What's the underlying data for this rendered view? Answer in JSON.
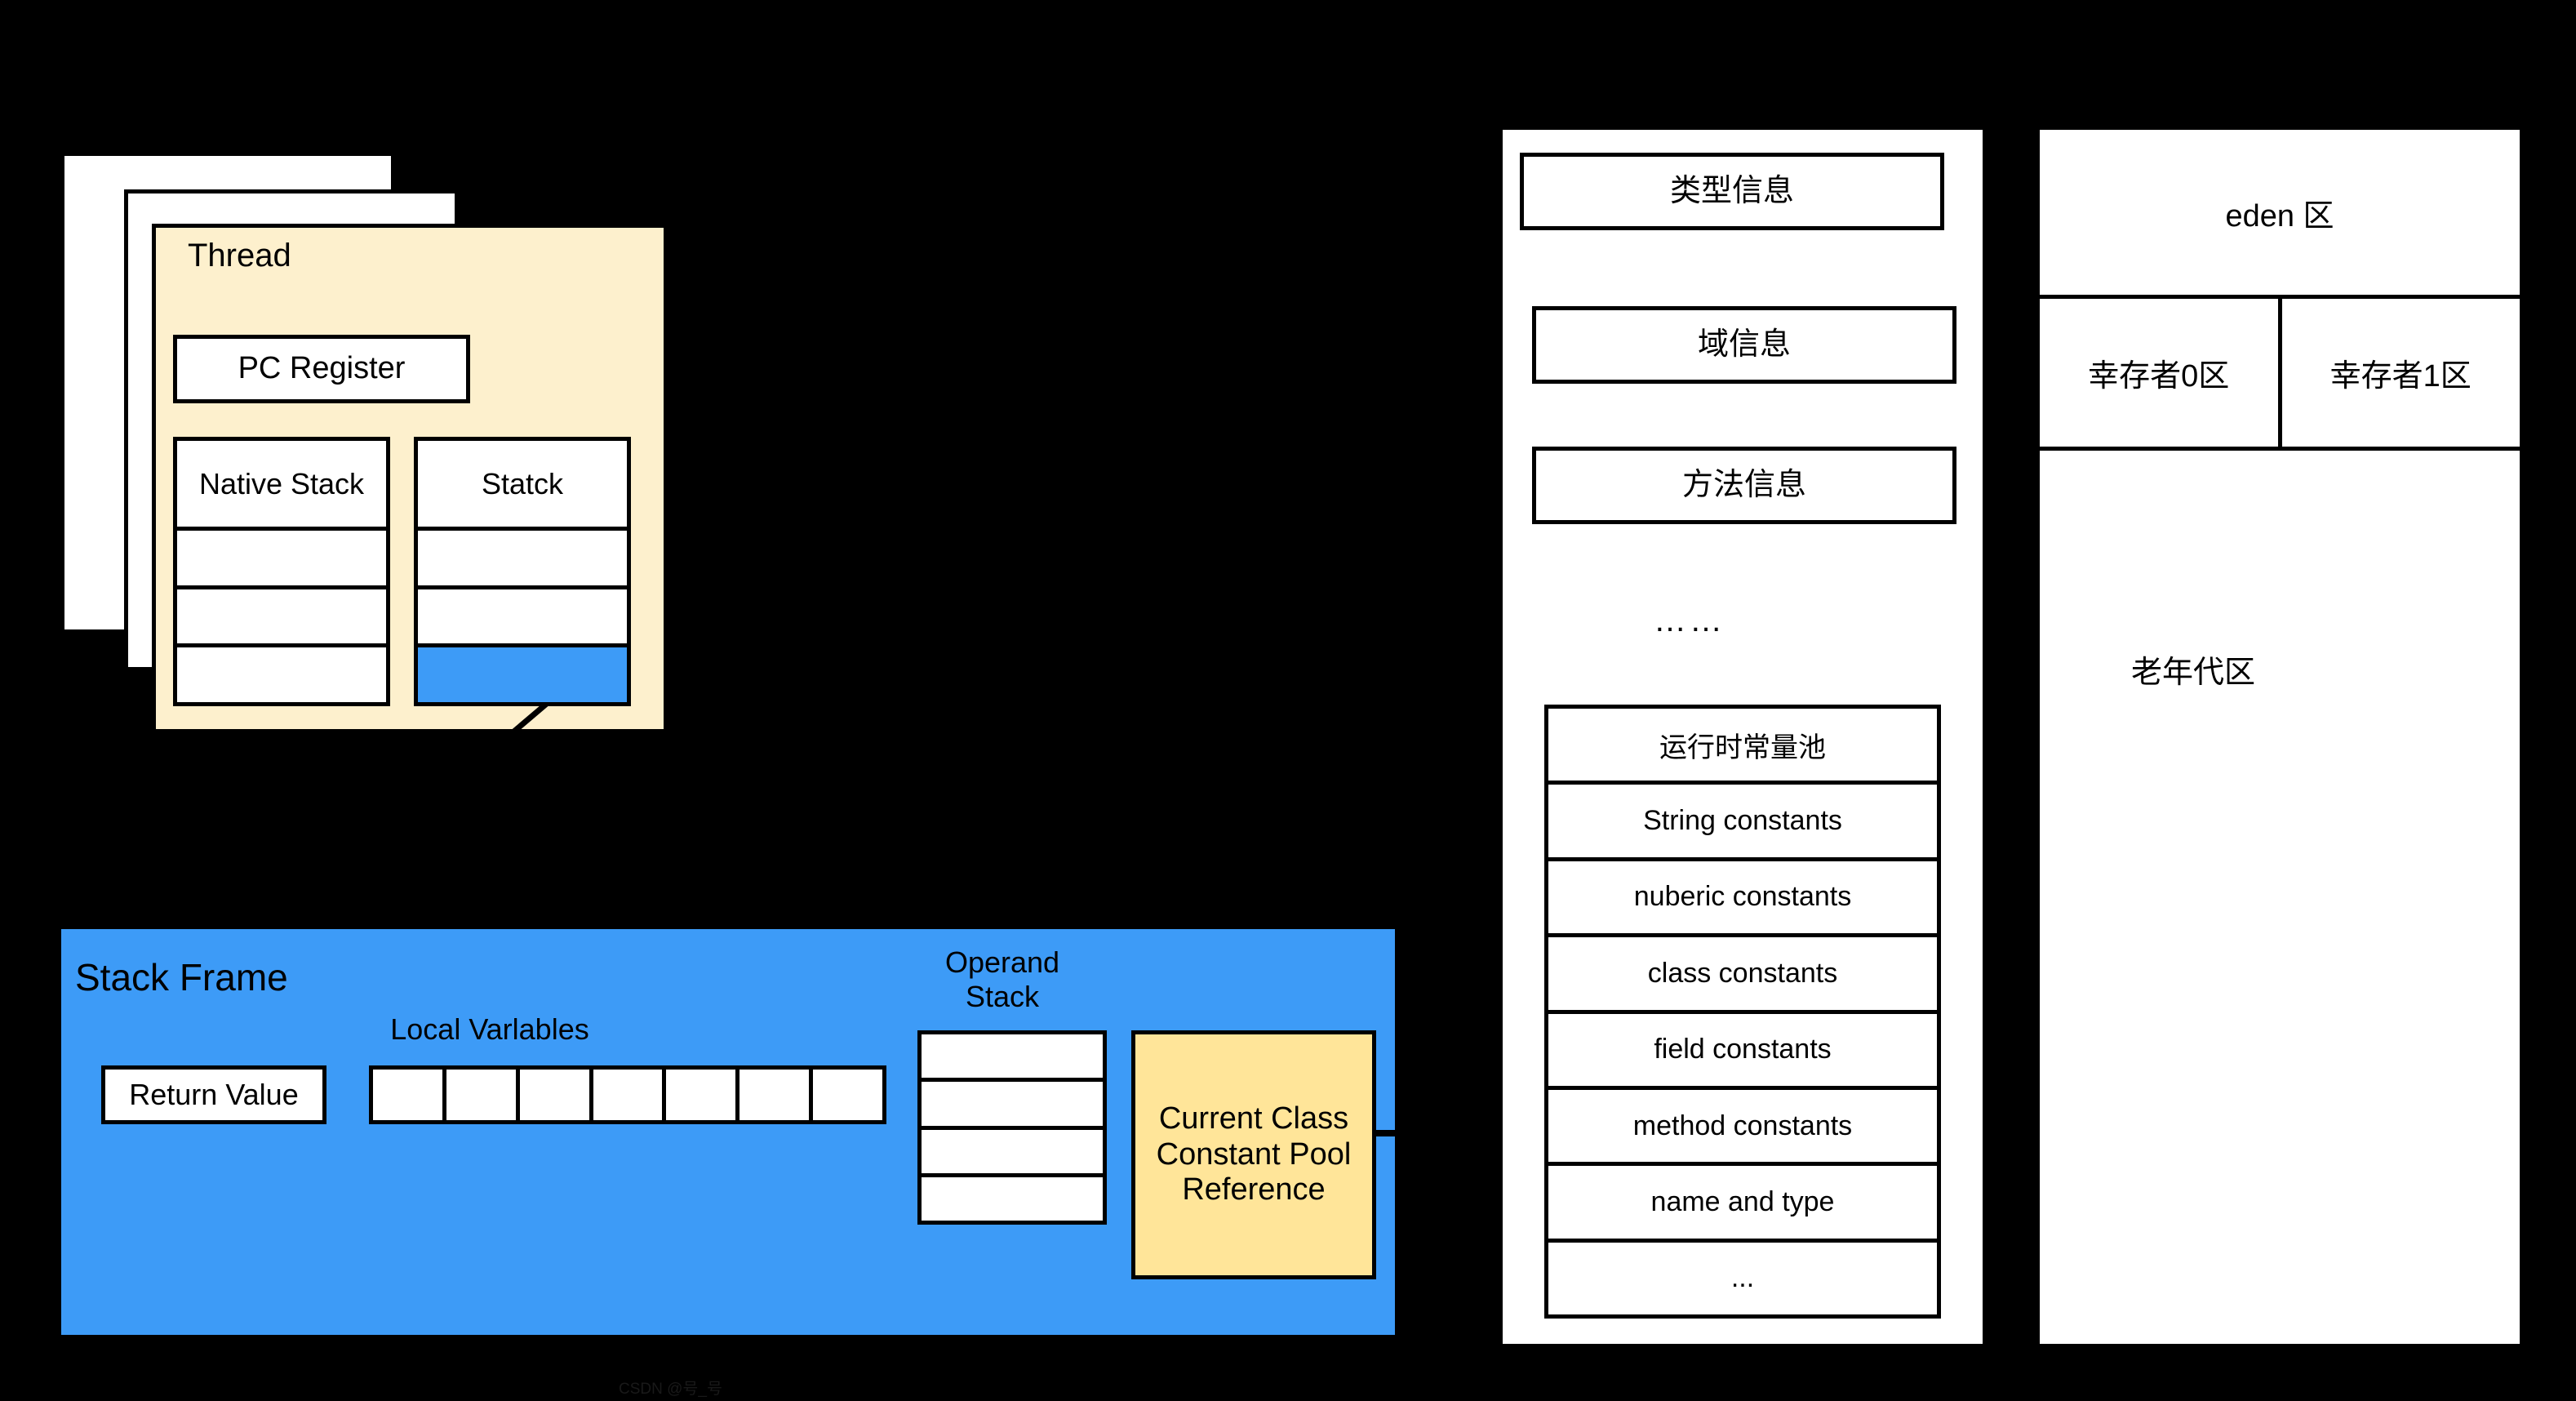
{
  "thread": {
    "title": "Thread",
    "pc_register": "PC Register",
    "native_stack": {
      "header": "Native Stack",
      "slots": [
        "",
        "",
        ""
      ]
    },
    "jvm_stack": {
      "header": "Statck",
      "slots": [
        "",
        "",
        ""
      ],
      "selected_index": 2
    }
  },
  "stack_frame": {
    "title": "Stack Frame",
    "return_value": "Return Value",
    "local_variables_label": "Local Varlables",
    "local_variable_cells": [
      "",
      "",
      "",
      "",
      "",
      "",
      ""
    ],
    "operand_stack_label_line1": "Operand",
    "operand_stack_label_line2": "Stack",
    "operand_stack_slots": [
      "",
      "",
      "",
      ""
    ],
    "current_class_constant_pool_reference": {
      "line1": "Current Class",
      "line2": "Constant Pool",
      "line3": "Reference"
    }
  },
  "method_area": {
    "type_info": "类型信息",
    "field_info": "域信息",
    "method_info": "方法信息",
    "ellipsis": "……",
    "runtime_constant_pool": [
      "运行时常量池",
      "String constants",
      "nuberic constants",
      "class constants",
      "field  constants",
      "method constants",
      "name and type",
      "..."
    ]
  },
  "heap": {
    "eden": "eden 区",
    "survivor_0": "幸存者0区",
    "survivor_1": "幸存者1区",
    "old_generation": "老年代区"
  },
  "watermark": "CSDN @号_号",
  "colors": {
    "background": "#000000",
    "accent_blue": "#3d9bf7",
    "thread_cream": "#fdf0cd",
    "constant_pool_yellow": "#ffe599",
    "stroke": "#000000",
    "surface": "#ffffff"
  }
}
